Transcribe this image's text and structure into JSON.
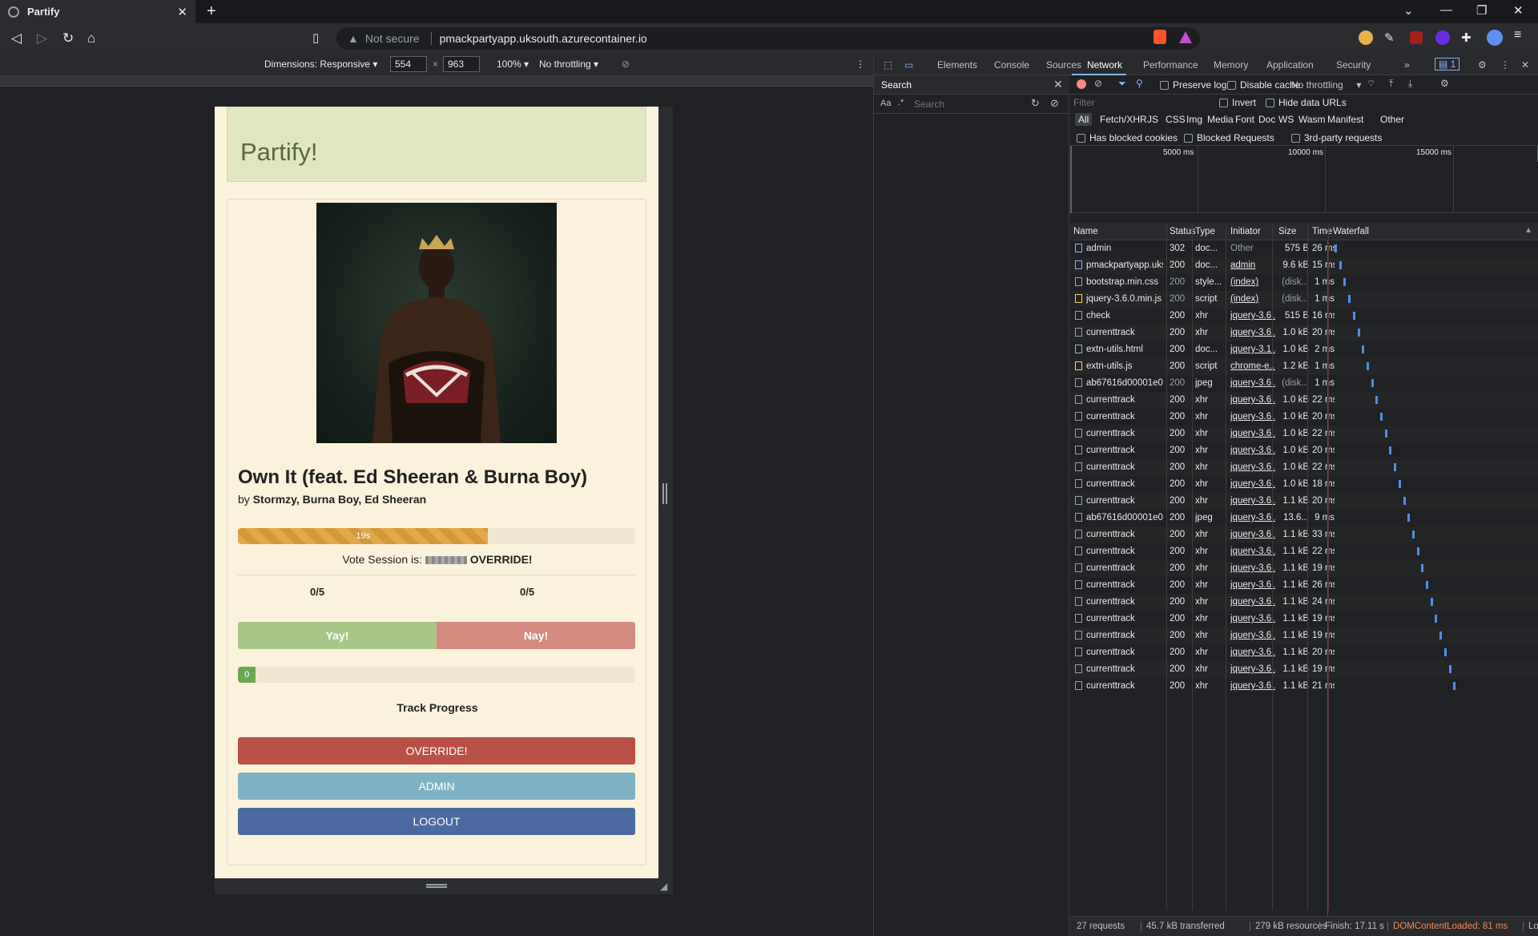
{
  "browser": {
    "tab_title": "Partify",
    "address_warning": "Not secure",
    "url": "pmackpartyapp.uksouth.azurecontainer.io"
  },
  "device_toolbar": {
    "dimensions_label": "Dimensions: Responsive",
    "width": "554",
    "height": "963",
    "times": "×",
    "zoom": "100%",
    "throttling": "No throttling"
  },
  "app": {
    "title": "Partify!",
    "song_title": "Own It (feat. Ed Sheeran & Burna Boy)",
    "by_prefix": "by",
    "artists": "Stormzy, Burna Boy, Ed Sheeran",
    "time_label": "19s",
    "time_progress": 0.63,
    "vote_prefix": "Vote Session is:",
    "vote_status": "OVERRIDE!",
    "yay_count": "0/5",
    "nay_count": "0/5",
    "yay_label": "Yay!",
    "nay_label": "Nay!",
    "track_progress_value": "0",
    "track_progress_fraction": 0.045,
    "track_progress_label": "Track Progress",
    "override_label": "OVERRIDE!",
    "admin_label": "ADMIN",
    "logout_label": "LOGOUT",
    "colors": {
      "override": "#b95046",
      "admin": "#7fb2c4",
      "logout": "#4a6aa0"
    }
  },
  "devtools": {
    "tabs": [
      "Elements",
      "Console",
      "Sources",
      "Network",
      "Performance",
      "Memory",
      "Application",
      "Security"
    ],
    "active_tab": "Network",
    "issues_badge": "1",
    "search_title": "Search",
    "search_placeholder": "Search",
    "case_toggle": "Aa",
    "regex_toggle": ".*",
    "preserve_log": "Preserve log",
    "disable_cache": "Disable cache",
    "throttling": "No throttling",
    "filter_placeholder": "Filter",
    "invert": "Invert",
    "hide_data_urls": "Hide data URLs",
    "type_filters": [
      "All",
      "Fetch/XHR",
      "JS",
      "CSS",
      "Img",
      "Media",
      "Font",
      "Doc",
      "WS",
      "Wasm",
      "Manifest",
      "Other"
    ],
    "has_blocked_cookies": "Has blocked cookies",
    "blocked_requests": "Blocked Requests",
    "third_party": "3rd-party requests",
    "timeline_ticks": [
      "5000 ms",
      "10000 ms",
      "15000 ms"
    ],
    "columns": [
      "Name",
      "Status",
      "Type",
      "Initiator",
      "Size",
      "Time",
      "Waterfall"
    ],
    "rows": [
      {
        "name": "admin",
        "status": "302",
        "type": "doc...",
        "initiator": "Other",
        "size": "575 B",
        "time": "26 ms"
      },
      {
        "name": "pmackpartyapp.uks...",
        "status": "200",
        "type": "doc...",
        "initiator": "admin",
        "size": "9.6 kB",
        "time": "15 ms"
      },
      {
        "name": "bootstrap.min.css",
        "status": "200",
        "type": "style...",
        "initiator": "(index)",
        "size": "(disk...",
        "time": "1 ms"
      },
      {
        "name": "jquery-3.6.0.min.js",
        "status": "200",
        "type": "script",
        "initiator": "(index)",
        "size": "(disk...",
        "time": "1 ms"
      },
      {
        "name": "check",
        "status": "200",
        "type": "xhr",
        "initiator": "jquery-3.6...",
        "size": "515 B",
        "time": "16 ms"
      },
      {
        "name": "currenttrack",
        "status": "200",
        "type": "xhr",
        "initiator": "jquery-3.6...",
        "size": "1.0 kB",
        "time": "20 ms"
      },
      {
        "name": "extn-utils.html",
        "status": "200",
        "type": "doc...",
        "initiator": "jquery-3.1...",
        "size": "1.0 kB",
        "time": "2 ms"
      },
      {
        "name": "extn-utils.js",
        "status": "200",
        "type": "script",
        "initiator": "chrome-e...",
        "size": "1.2 kB",
        "time": "1 ms"
      },
      {
        "name": "ab67616d00001e02...",
        "status": "200",
        "type": "jpeg",
        "initiator": "jquery-3.6...",
        "size": "(disk...",
        "time": "1 ms"
      },
      {
        "name": "currenttrack",
        "status": "200",
        "type": "xhr",
        "initiator": "jquery-3.6...",
        "size": "1.0 kB",
        "time": "22 ms"
      },
      {
        "name": "currenttrack",
        "status": "200",
        "type": "xhr",
        "initiator": "jquery-3.6...",
        "size": "1.0 kB",
        "time": "20 ms"
      },
      {
        "name": "currenttrack",
        "status": "200",
        "type": "xhr",
        "initiator": "jquery-3.6...",
        "size": "1.0 kB",
        "time": "22 ms"
      },
      {
        "name": "currenttrack",
        "status": "200",
        "type": "xhr",
        "initiator": "jquery-3.6...",
        "size": "1.0 kB",
        "time": "20 ms"
      },
      {
        "name": "currenttrack",
        "status": "200",
        "type": "xhr",
        "initiator": "jquery-3.6...",
        "size": "1.0 kB",
        "time": "22 ms"
      },
      {
        "name": "currenttrack",
        "status": "200",
        "type": "xhr",
        "initiator": "jquery-3.6...",
        "size": "1.0 kB",
        "time": "18 ms"
      },
      {
        "name": "currenttrack",
        "status": "200",
        "type": "xhr",
        "initiator": "jquery-3.6...",
        "size": "1.1 kB",
        "time": "20 ms"
      },
      {
        "name": "ab67616d00001e02...",
        "status": "200",
        "type": "jpeg",
        "initiator": "jquery-3.6...",
        "size": "13.6...",
        "time": "9 ms"
      },
      {
        "name": "currenttrack",
        "status": "200",
        "type": "xhr",
        "initiator": "jquery-3.6...",
        "size": "1.1 kB",
        "time": "33 ms"
      },
      {
        "name": "currenttrack",
        "status": "200",
        "type": "xhr",
        "initiator": "jquery-3.6...",
        "size": "1.1 kB",
        "time": "22 ms"
      },
      {
        "name": "currenttrack",
        "status": "200",
        "type": "xhr",
        "initiator": "jquery-3.6...",
        "size": "1.1 kB",
        "time": "19 ms"
      },
      {
        "name": "currenttrack",
        "status": "200",
        "type": "xhr",
        "initiator": "jquery-3.6...",
        "size": "1.1 kB",
        "time": "26 ms"
      },
      {
        "name": "currenttrack",
        "status": "200",
        "type": "xhr",
        "initiator": "jquery-3.6...",
        "size": "1.1 kB",
        "time": "24 ms"
      },
      {
        "name": "currenttrack",
        "status": "200",
        "type": "xhr",
        "initiator": "jquery-3.6...",
        "size": "1.1 kB",
        "time": "19 ms"
      },
      {
        "name": "currenttrack",
        "status": "200",
        "type": "xhr",
        "initiator": "jquery-3.6...",
        "size": "1.1 kB",
        "time": "19 ms"
      },
      {
        "name": "currenttrack",
        "status": "200",
        "type": "xhr",
        "initiator": "jquery-3.6...",
        "size": "1.1 kB",
        "time": "20 ms"
      },
      {
        "name": "currenttrack",
        "status": "200",
        "type": "xhr",
        "initiator": "jquery-3.6...",
        "size": "1.1 kB",
        "time": "19 ms"
      },
      {
        "name": "currenttrack",
        "status": "200",
        "type": "xhr",
        "initiator": "jquery-3.6...",
        "size": "1.1 kB",
        "time": "21 ms"
      }
    ],
    "summary": {
      "requests": "27 requests",
      "transferred": "45.7 kB transferred",
      "resources": "279 kB resources",
      "finish": "Finish: 17.11 s",
      "dom_loaded": "DOMContentLoaded: 81 ms",
      "truncated": "Lo"
    }
  }
}
